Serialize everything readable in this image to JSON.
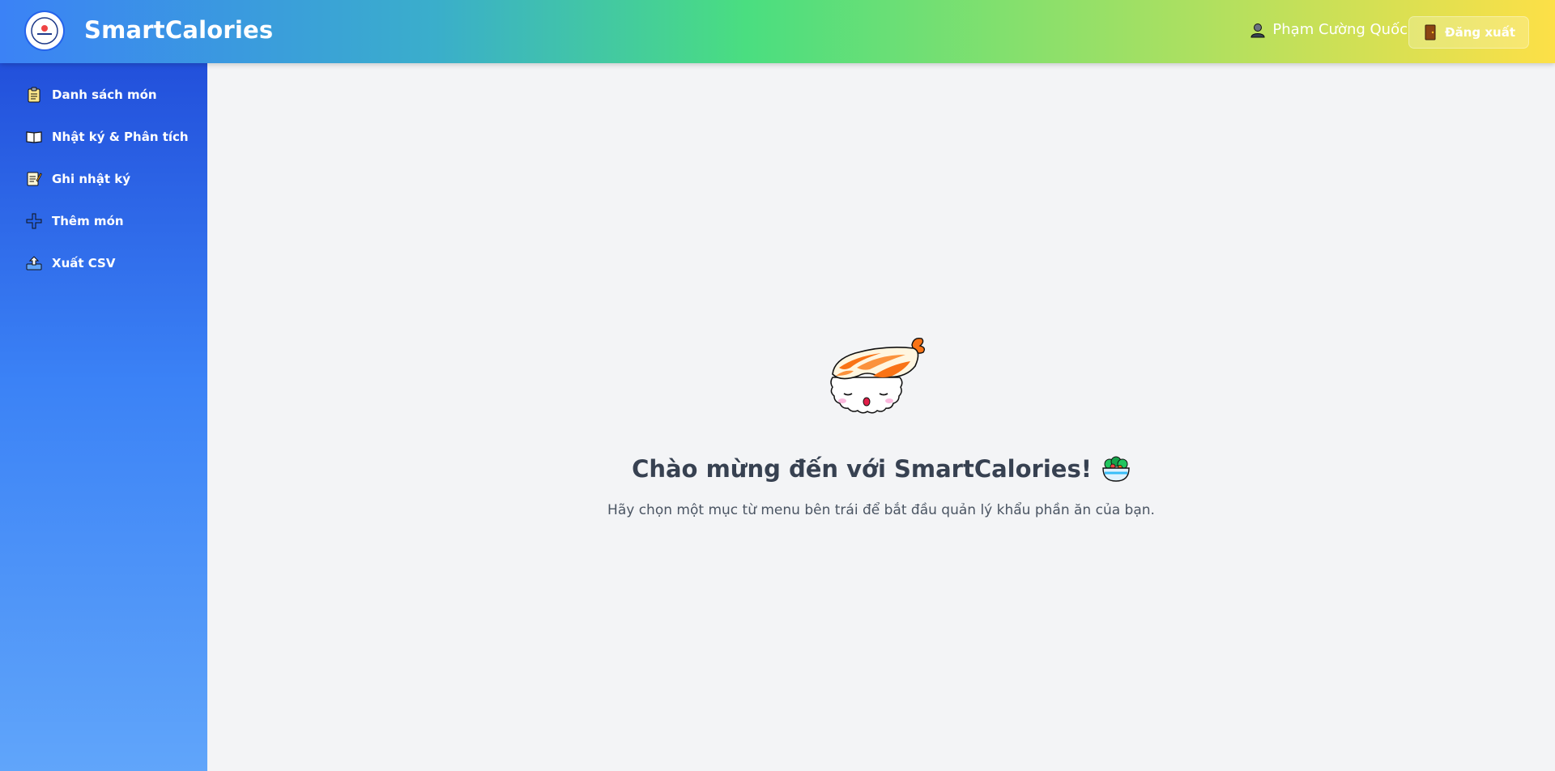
{
  "header": {
    "brand": "SmartCalories",
    "logo_icon": "smartcalories-logo",
    "user_name": "Phạm Cường Quốc",
    "logout_label": "Đăng xuất"
  },
  "sidebar": {
    "items": [
      {
        "label": "Danh sách món",
        "icon": "clipboard-icon"
      },
      {
        "label": "Nhật ký & Phân tích",
        "icon": "book-icon"
      },
      {
        "label": "Ghi nhật ký",
        "icon": "memo-icon"
      },
      {
        "label": "Thêm món",
        "icon": "plus-icon"
      },
      {
        "label": "Xuất CSV",
        "icon": "upload-tray-icon"
      }
    ]
  },
  "main": {
    "welcome_title": "Chào mừng đến với SmartCalories!",
    "welcome_subtitle": "Hãy chọn một mục từ menu bên trái để bắt đầu quản lý khẩu phần ăn của bạn."
  },
  "colors": {
    "sidebar_top": "#2250db",
    "sidebar_bottom": "#60a5fa",
    "header_left": "#3b82f6",
    "header_mid": "#4ade80",
    "header_right": "#fde047",
    "main_bg": "#f3f4f6",
    "title_text": "#374151"
  }
}
